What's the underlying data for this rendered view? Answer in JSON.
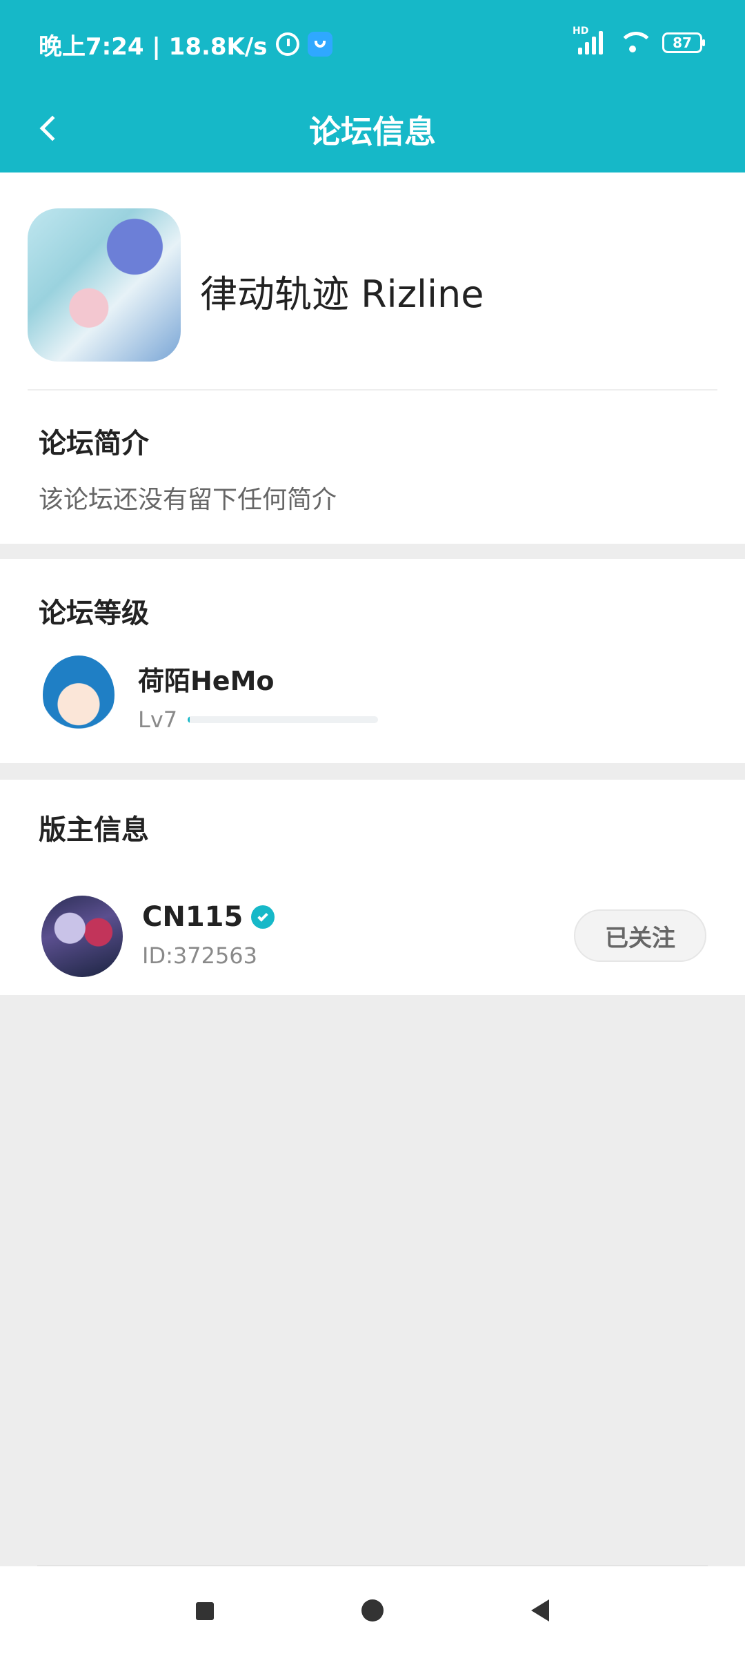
{
  "status_bar": {
    "time_text": "晚上7:24 | 18.8K/s",
    "battery": "87"
  },
  "header": {
    "title": "论坛信息"
  },
  "forum": {
    "name": "律动轨迹 Rizline",
    "intro_title": "论坛简介",
    "intro_text": "该论坛还没有留下任何简介"
  },
  "level": {
    "title": "论坛等级",
    "user_name": "荷陌HeMo",
    "lv_label": "Lv7",
    "progress_fraction": 0.01
  },
  "moderator": {
    "title": "版主信息",
    "name": "CN115",
    "id_text": "ID:372563",
    "follow_label": "已关注"
  },
  "colors": {
    "accent": "#16b8c8",
    "background": "#ededed",
    "card": "#ffffff"
  }
}
